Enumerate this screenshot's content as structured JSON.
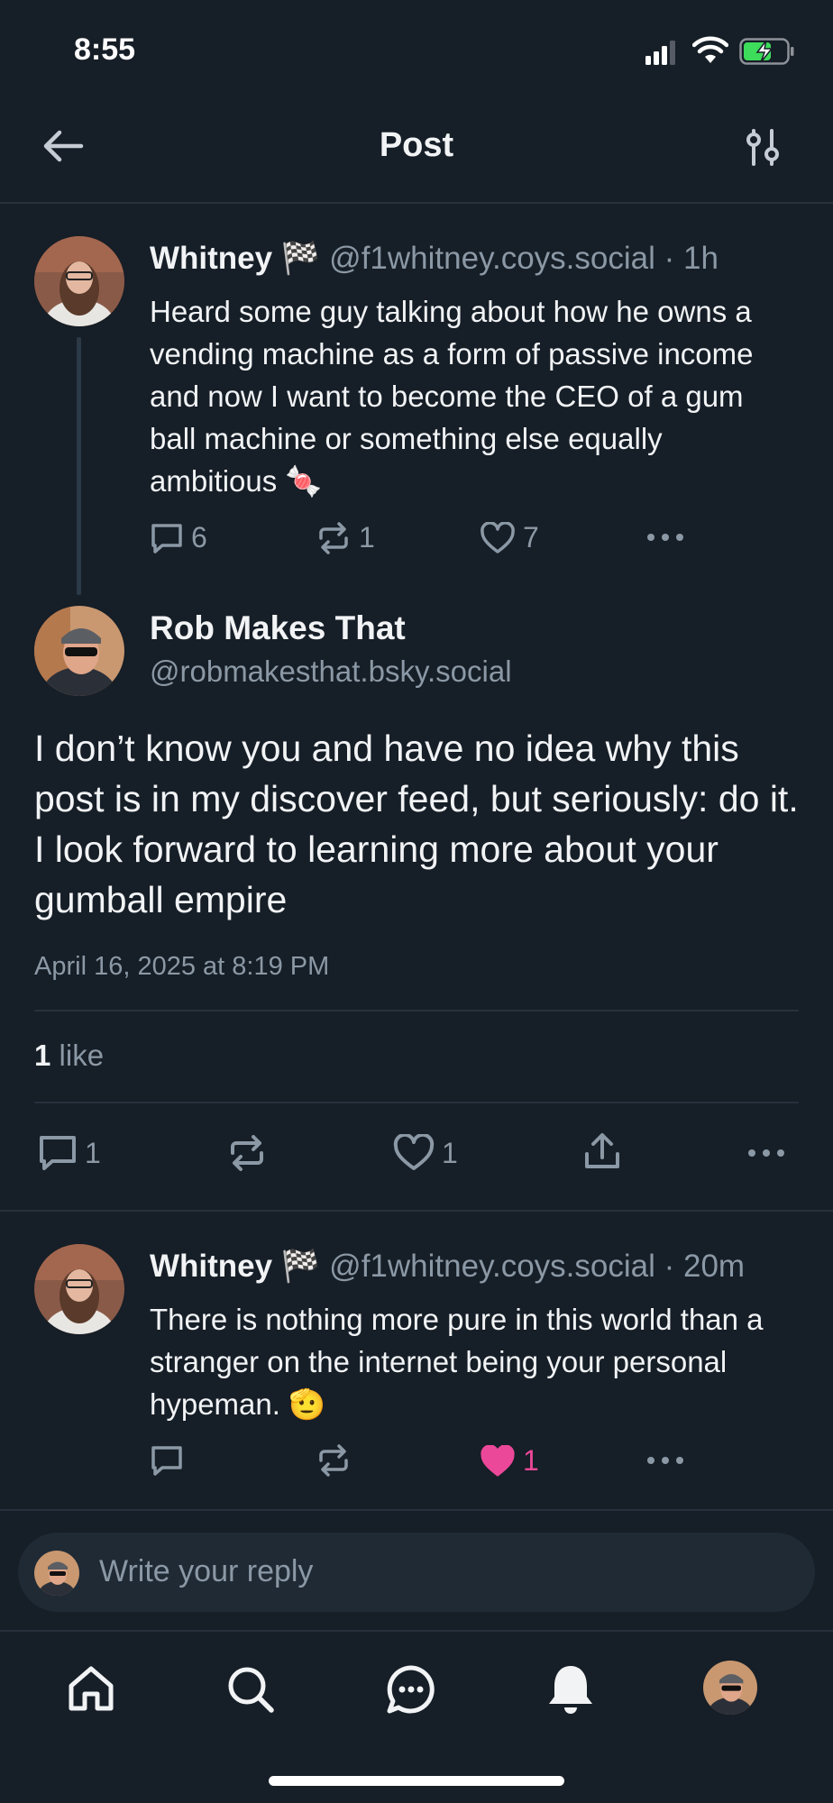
{
  "status_bar": {
    "time": "8:55"
  },
  "header": {
    "title": "Post"
  },
  "parent_post": {
    "display_name": "Whitney",
    "flag": "🏁",
    "handle": "@f1whitney.coys.social",
    "time": "· 1h",
    "text": "Heard some guy talking about how he owns a vending machine as a form of passive income and now I want to become the CEO of a gum ball machine or something else equally ambitious 🍬",
    "replies": "6",
    "reposts": "1",
    "likes": "7"
  },
  "main_post": {
    "display_name": "Rob Makes That",
    "handle": "@robmakesthat.bsky.social",
    "text": "I don’t know you and have no idea why this post is in my discover feed, but seriously: do it. I look forward to learning more about your gumball empire",
    "timestamp": "April 16, 2025 at 8:19 PM",
    "like_count": "1",
    "like_label": "like",
    "replies": "1",
    "likes": "1"
  },
  "reply_post": {
    "display_name": "Whitney",
    "flag": "🏁",
    "handle": "@f1whitney.coys.social",
    "time": "· 20m",
    "text": "There is nothing more pure in this world than a stranger on the internet being your personal hypeman. 🫡",
    "likes": "1"
  },
  "composer": {
    "placeholder": "Write your reply"
  },
  "colors": {
    "background": "#161e27",
    "muted": "#8b98a5",
    "like_active": "#ec4899",
    "divider": "#26313d"
  },
  "nav": [
    "home-icon",
    "search-icon",
    "chat-icon",
    "bell-icon",
    "profile-avatar"
  ]
}
